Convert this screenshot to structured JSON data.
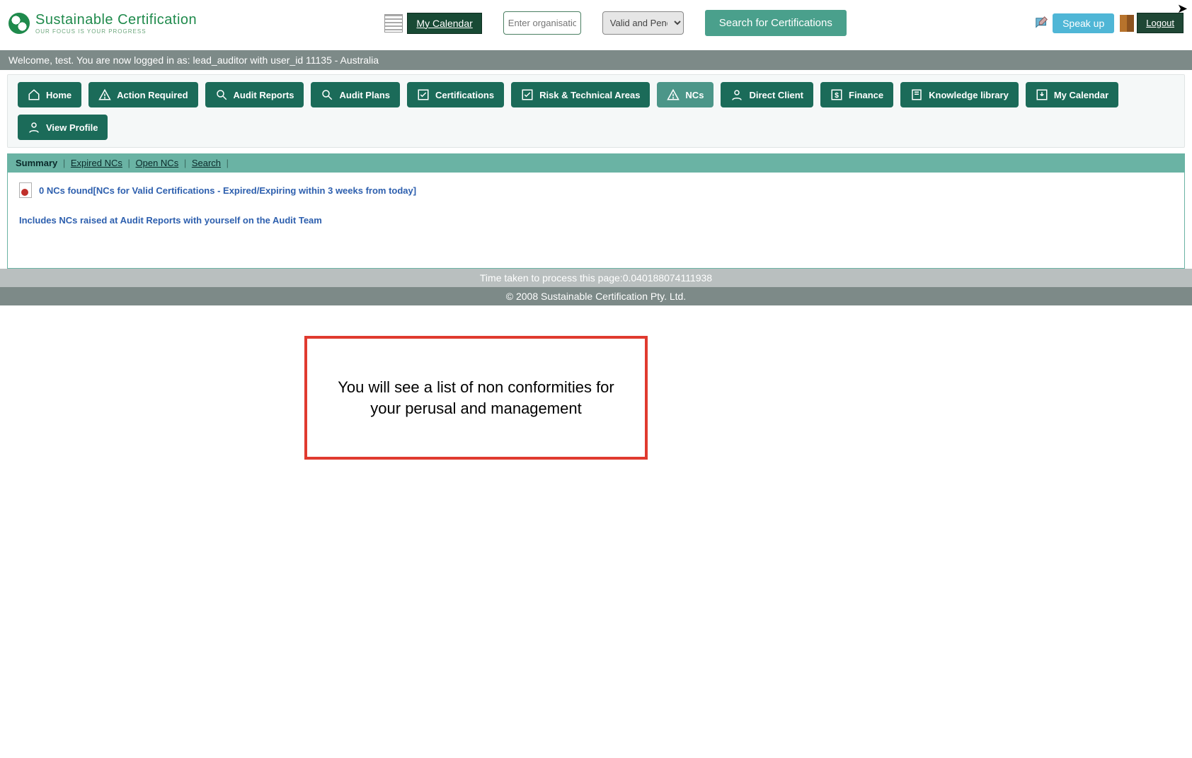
{
  "logo": {
    "line1": "Sustainable Certification",
    "line2": "OUR FOCUS IS YOUR PROGRESS"
  },
  "header": {
    "my_calendar": "My Calendar",
    "org_placeholder": "Enter organisation name",
    "status_selected": "Valid and Pending",
    "search_btn": "Search for Certifications",
    "speak_up": "Speak up",
    "logout": "Logout"
  },
  "welcome": "Welcome, test. You are now logged in as: lead_auditor with user_id 11135 - Australia",
  "nav": [
    {
      "label": "Home",
      "icon": "home"
    },
    {
      "label": "Action Required",
      "icon": "warn"
    },
    {
      "label": "Audit Reports",
      "icon": "search-doc"
    },
    {
      "label": "Audit Plans",
      "icon": "search-doc"
    },
    {
      "label": "Certifications",
      "icon": "check"
    },
    {
      "label": "Risk & Technical Areas",
      "icon": "check"
    },
    {
      "label": "NCs",
      "icon": "warn",
      "active": true
    },
    {
      "label": "Direct Client",
      "icon": "person"
    },
    {
      "label": "Finance",
      "icon": "dollar"
    },
    {
      "label": "Knowledge library",
      "icon": "book"
    },
    {
      "label": "My Calendar",
      "icon": "download"
    },
    {
      "label": "View Profile",
      "icon": "person"
    }
  ],
  "subtabs": {
    "summary": "Summary",
    "expired": "Expired  NCs",
    "open": "Open  NCs",
    "search": "Search"
  },
  "content": {
    "line1": "0 NCs found[NCs for Valid Certifications - Expired/Expiring within 3 weeks from today]",
    "line2": "Includes NCs raised at Audit Reports with yourself on the Audit Team"
  },
  "timebar": "Time taken to process this page:0.040188074111938",
  "copybar": "© 2008 Sustainable Certification Pty. Ltd.",
  "annotation": "You will see a list of non conformities  for your perusal and management"
}
